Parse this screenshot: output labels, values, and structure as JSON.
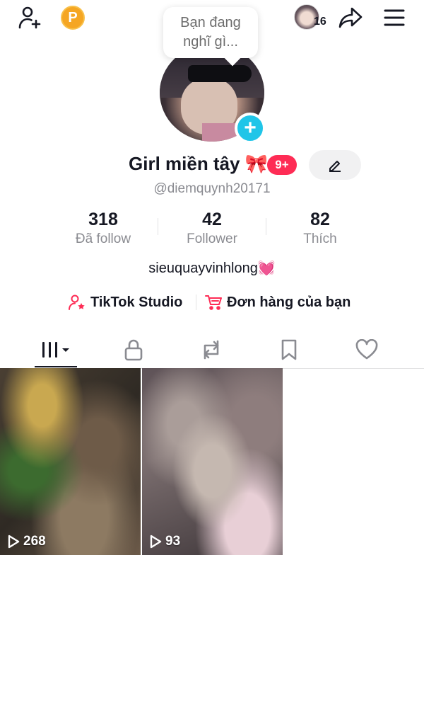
{
  "header": {
    "add_friend_icon": "person-plus-icon",
    "points_badge": "P",
    "bubble_line1": "Bạn đang",
    "bubble_line2": "nghĩ gì...",
    "visitor_count": "16",
    "share_icon": "share-arrow-icon",
    "menu_icon": "hamburger-icon"
  },
  "profile": {
    "name": "Girl miền tây 🎀",
    "notification_badge": "9+",
    "handle": "@diemquynh20171",
    "bio": "sieuquayvinhlong💓",
    "stats": [
      {
        "value": "318",
        "label": "Đã follow"
      },
      {
        "value": "42",
        "label": "Follower"
      },
      {
        "value": "82",
        "label": "Thích"
      }
    ]
  },
  "links": {
    "studio": "TikTok Studio",
    "orders": "Đơn hàng của bạn"
  },
  "tabs": [
    "videos-grid-icon",
    "lock-icon",
    "repost-icon",
    "bookmark-icon",
    "heart-icon"
  ],
  "videos": [
    {
      "views": "268"
    },
    {
      "views": "93"
    }
  ],
  "colors": {
    "accent": "#FE2C55",
    "cyan": "#20C5E8",
    "points": "#F5A623"
  }
}
